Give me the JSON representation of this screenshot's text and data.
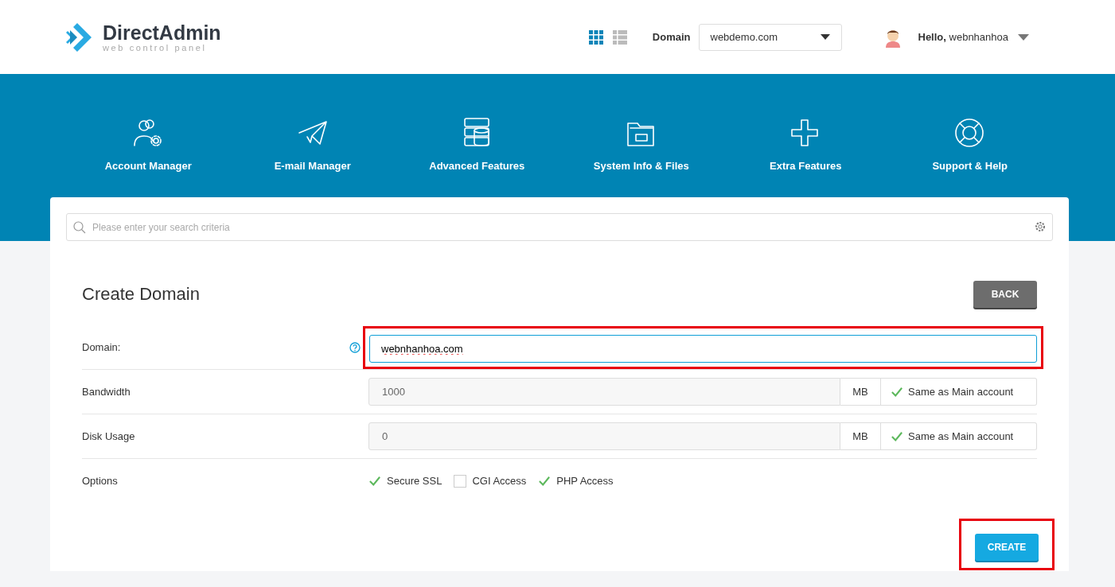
{
  "logo": {
    "name": "DirectAdmin",
    "tagline": "web control panel"
  },
  "header": {
    "view_modes": [
      {
        "kind": "grid",
        "selected": true
      },
      {
        "kind": "list",
        "selected": false
      }
    ],
    "domain_label": "Domain",
    "domain_select": "webdemo.com",
    "greeting": "Hello,",
    "user": "webnhanhoa"
  },
  "nav": [
    {
      "kind": "account",
      "label": "Account Manager"
    },
    {
      "kind": "email",
      "label": "E-mail Manager"
    },
    {
      "kind": "advanced",
      "label": "Advanced Features"
    },
    {
      "kind": "files",
      "label": "System Info & Files"
    },
    {
      "kind": "extra",
      "label": "Extra Features"
    },
    {
      "kind": "support",
      "label": "Support & Help"
    }
  ],
  "search": {
    "placeholder": "Please enter your search criteria"
  },
  "page_title": "Create Domain",
  "back_button": "BACK",
  "form": [
    {
      "kind": "text",
      "label": "Domain:",
      "help": true,
      "value": "webnhanhoa.com",
      "highlighted": true
    },
    {
      "kind": "quota",
      "label": "Bandwidth",
      "value": "1000",
      "unit": "MB",
      "same_as_main": {
        "label": "Same as Main account",
        "checked": true
      }
    },
    {
      "kind": "quota",
      "label": "Disk Usage",
      "value": "0",
      "unit": "MB",
      "same_as_main": {
        "label": "Same as Main account",
        "checked": true
      }
    },
    {
      "kind": "options",
      "label": "Options",
      "options": [
        {
          "label": "Secure SSL",
          "checked": true
        },
        {
          "label": "CGI Access",
          "checked": false
        },
        {
          "label": "PHP Access",
          "checked": true
        }
      ]
    }
  ],
  "create_button": {
    "label": "CREATE",
    "highlighted": true
  }
}
